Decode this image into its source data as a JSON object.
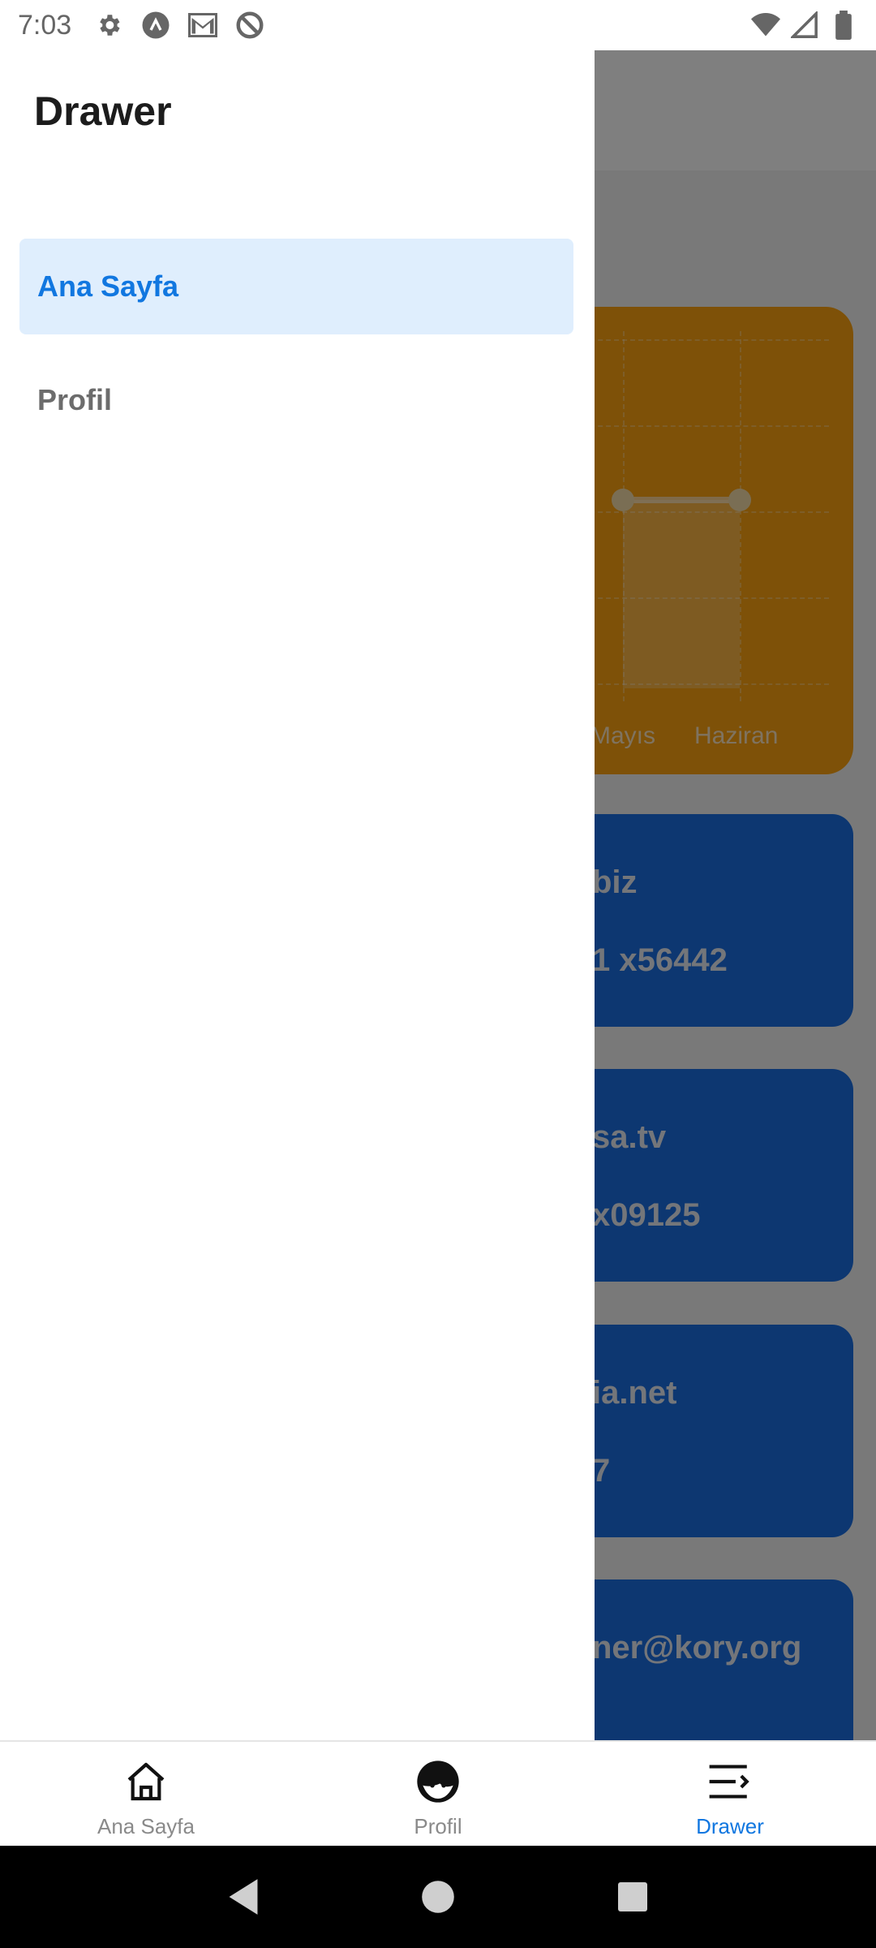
{
  "status_bar": {
    "time": "7:03",
    "left_icons": [
      "gear-icon",
      "a-circle-icon",
      "gmail-icon",
      "do-not-disturb-icon"
    ],
    "right_icons": [
      "wifi-icon",
      "signal-icon",
      "battery-icon"
    ]
  },
  "drawer": {
    "title": "Drawer",
    "items": [
      {
        "label": "Ana Sayfa",
        "active": true
      },
      {
        "label": "Profil",
        "active": false
      }
    ]
  },
  "background": {
    "chart": {
      "x_labels_visible": [
        "Mayıs",
        "Haziran"
      ],
      "color": "#fca311"
    },
    "contacts": [
      {
        "line1": "biz",
        "line2": "1 x56442"
      },
      {
        "line1": "sa.tv",
        "line2": "x09125"
      },
      {
        "line1": "ia.net",
        "line2": "7"
      },
      {
        "line1": "ner@kory.org",
        "line2": ""
      }
    ],
    "card_color": "#1a6fe3"
  },
  "tab_bar": {
    "tabs": [
      {
        "label": "Ana Sayfa",
        "icon": "home-icon",
        "active": false
      },
      {
        "label": "Profil",
        "icon": "face-icon",
        "active": false
      },
      {
        "label": "Drawer",
        "icon": "menu-icon",
        "active": true
      }
    ],
    "active_color": "#1177e0"
  },
  "nav_bar": {
    "buttons": [
      "back-icon",
      "home-circle-icon",
      "recents-icon"
    ]
  }
}
